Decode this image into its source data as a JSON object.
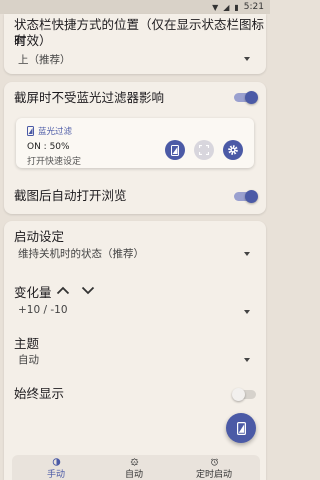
{
  "status_bar": {
    "time": "5:21"
  },
  "card1": {
    "title_line1": "状态栏快捷方式的位置（仅在显示状态栏图标时",
    "title_line2": "有效）",
    "value": "上（推荐）"
  },
  "card2": {
    "screenshot_title": "截屏时不受蓝光过滤器影响",
    "screenshot_toggle_on": true,
    "tile": {
      "name": "蓝光过滤",
      "status": "ON : 50%",
      "action": "打开快速设定"
    },
    "auto_open_title": "截图后自动打开浏览",
    "auto_open_toggle_on": true
  },
  "card3": {
    "startup_title": "启动设定",
    "startup_value": "维持关机时的状态（推荐）",
    "step_title": "变化量",
    "step_value": "+10 / -10",
    "theme_title": "主题",
    "theme_value": "自动",
    "always_show_title": "始终显示",
    "always_show_toggle_on": false
  },
  "bottom_nav": {
    "items": [
      {
        "label": "手动",
        "icon": "brightness-icon",
        "active": true
      },
      {
        "label": "自动",
        "icon": "auto-mode-icon",
        "active": false
      },
      {
        "label": "定时启动",
        "icon": "alarm-icon",
        "active": false
      }
    ]
  },
  "colors": {
    "accent": "#4b5aa6",
    "track_on": "#9aa0cf",
    "track_off": "#d6d2cc",
    "background": "#e8e1d8",
    "card": "#f4efe8"
  }
}
